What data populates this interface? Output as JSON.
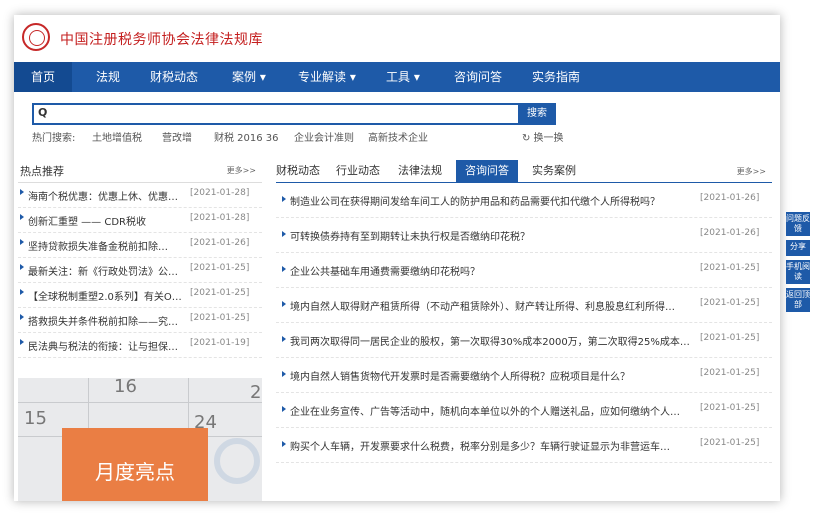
{
  "site": {
    "name": "中国注册税务师协会法律法规库"
  },
  "nav": {
    "items": [
      {
        "label": "首页"
      },
      {
        "label": "法规"
      },
      {
        "label": "财税动态"
      },
      {
        "label": "案例 ▾"
      },
      {
        "label": "专业解读 ▾"
      },
      {
        "label": "工具 ▾"
      },
      {
        "label": "咨询问答"
      },
      {
        "label": "实务指南"
      }
    ]
  },
  "search": {
    "icon": "search-icon",
    "button_label": "搜索",
    "hot_label": "热门搜索:",
    "hot_terms": [
      "土地增值税",
      "营改增",
      "财税 2016 36",
      "企业会计准则",
      "高新技术企业"
    ],
    "refresh_label": "↻ 换一换"
  },
  "hot_recommend": {
    "title": "热点推荐",
    "more": "更多>>",
    "items": [
      {
        "title": "海南个税优惠：优惠上休、优惠…",
        "date": "[2021-01-28]"
      },
      {
        "title": "创新汇重塑 —— CDR税收",
        "date": "[2021-01-28]"
      },
      {
        "title": "坚持贷款损失准备金税前扣除…",
        "date": "[2021-01-26]"
      },
      {
        "title": "最新关注：新《行政处罚法》公…",
        "date": "[2021-01-25]"
      },
      {
        "title": "【全球税制重塑2.0系列】有关O…",
        "date": "[2021-01-25]"
      },
      {
        "title": "搭救损失并条件税前扣除——究…",
        "date": "[2021-01-25]"
      },
      {
        "title": "民法典与税法的衔接：让与担保…",
        "date": "[2021-01-19]"
      }
    ]
  },
  "banner": {
    "text": "月度亮点"
  },
  "tabs": {
    "items": [
      {
        "label": "财税动态"
      },
      {
        "label": "行业动态"
      },
      {
        "label": "法律法规"
      },
      {
        "label": "咨询问答"
      },
      {
        "label": "实务案例"
      }
    ],
    "more": "更多>>"
  },
  "news": [
    {
      "title": "制造业公司在获得期间发给车间工人的防护用品和药品需要代扣代缴个人所得税吗？",
      "date": "[2021-01-26]"
    },
    {
      "title": "可转换债券持有至到期转让未执行权是否缴纳印花税？",
      "date": "[2021-01-26]"
    },
    {
      "title": "企业公共基础车用通费需要缴纳印花税吗？",
      "date": "[2021-01-25]"
    },
    {
      "title": "境内自然人取得财产租赁所得（不动产租赁除外）、财产转让所得、利息股息红利所得…",
      "date": "[2021-01-25]"
    },
    {
      "title": "我司两次取得同一居民企业的股权，第一次取得30%成本2000万，第二次取得25%成本…",
      "date": "[2021-01-25]"
    },
    {
      "title": "境内自然人销售货物代开发票时是否需要缴纳个人所得税？应税项目是什么？",
      "date": "[2021-01-25]"
    },
    {
      "title": "企业在业务宣传、广告等活动中，随机向本单位以外的个人赠送礼品，应如何缴纳个人…",
      "date": "[2021-01-25]"
    },
    {
      "title": "购买个人车辆，开发票要求什么税费，税率分别是多少？车辆行驶证显示为非营运车…",
      "date": "[2021-01-25]"
    }
  ],
  "side_tools": [
    {
      "label": "问题反馈"
    },
    {
      "label": "分享"
    },
    {
      "label": "手机阅读"
    },
    {
      "label": "返回顶部"
    }
  ],
  "colors": {
    "primary": "#1e5aa8",
    "brand_red": "#c41f1f",
    "banner_orange": "#ea7e44"
  }
}
